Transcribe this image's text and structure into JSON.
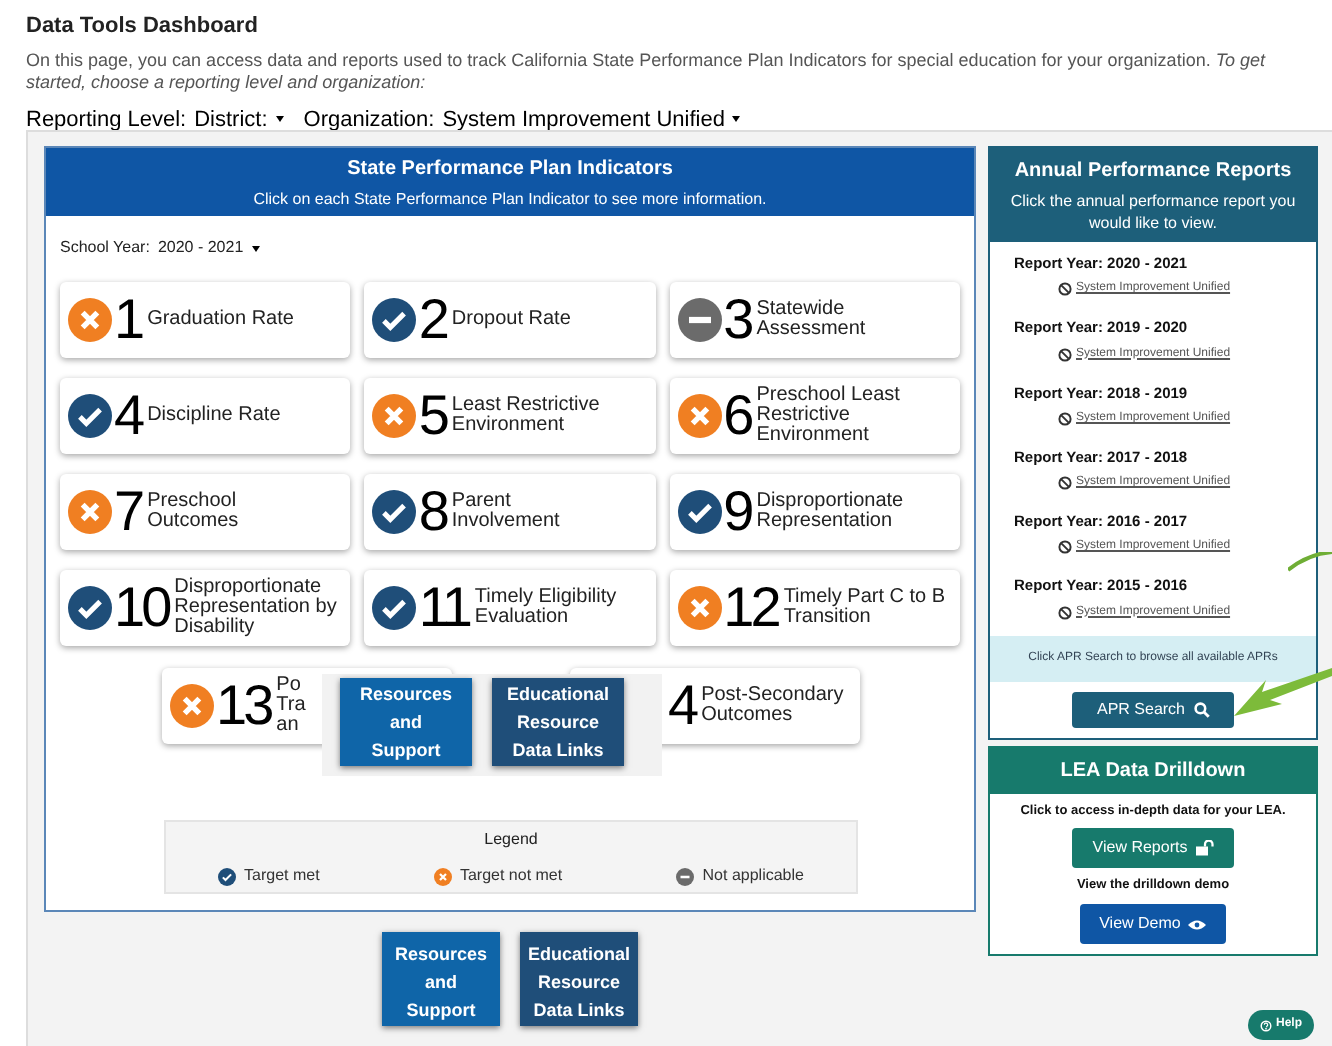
{
  "page": {
    "title": "Data Tools Dashboard",
    "intro": "On this page, you can access data and reports used to track California State Performance Plan Indicators for special education for your organization. *To get started, choose a reporting level and organization:*"
  },
  "filters": [
    {
      "label": "Reporting Level:",
      "value": "District:"
    },
    {
      "label": "Organization:",
      "value": "System Improvement Unified"
    }
  ],
  "indicators_panel": {
    "title": "State Performance Plan Indicators",
    "subtitle": "Click on each State Performance Plan Indicator to see more information.",
    "school_year_label": "School Year:",
    "school_year": "2020 - 2021",
    "indicators": [
      {
        "kind": "not_met",
        "number": "1",
        "label": [
          "Graduation Rate"
        ]
      },
      {
        "kind": "met",
        "number": "2",
        "label": [
          "Dropout Rate"
        ]
      },
      {
        "kind": "na",
        "number": "3",
        "label": [
          "Statewide",
          "Assessment"
        ]
      },
      {
        "kind": "met",
        "number": "4",
        "label": [
          "Discipline Rate"
        ]
      },
      {
        "kind": "not_met",
        "number": "5",
        "label": [
          "Least Restrictive",
          "Environment"
        ]
      },
      {
        "kind": "not_met",
        "number": "6",
        "label": [
          "Preschool Least",
          "Restrictive",
          "Environment"
        ]
      },
      {
        "kind": "not_met",
        "number": "7",
        "label": [
          "Preschool",
          "Outcomes"
        ]
      },
      {
        "kind": "met",
        "number": "8",
        "label": [
          "Parent",
          "Involvement"
        ]
      },
      {
        "kind": "met",
        "number": "9",
        "label": [
          "Disproportionate",
          "Representation"
        ]
      },
      {
        "kind": "met",
        "number": "10",
        "label": [
          "Disproportionate",
          "Representation by",
          "Disability"
        ]
      },
      {
        "kind": "met",
        "number": "11",
        "label": [
          "Timely Eligibility",
          "Evaluation"
        ]
      },
      {
        "kind": "not_met",
        "number": "12",
        "label": [
          "Timely Part C to B",
          "Transition"
        ]
      }
    ],
    "partial_indicators": [
      {
        "kind": "not_met",
        "number": "13",
        "label": [
          "Po",
          "Tra",
          "an"
        ]
      },
      {
        "number": "4",
        "label": [
          "Post-Secondary",
          "Outcomes"
        ]
      }
    ],
    "overlay_links": [
      {
        "kind": "light",
        "lines": [
          "Resources",
          "and",
          "Support"
        ]
      },
      {
        "kind": "dark",
        "lines": [
          "Educational",
          "Resource",
          "Data Links"
        ]
      }
    ],
    "legend": {
      "title": "Legend",
      "items": [
        {
          "kind": "met",
          "label": "Target met"
        },
        {
          "kind": "not_met",
          "label": "Target not met"
        },
        {
          "kind": "na",
          "label": "Not applicable"
        }
      ]
    }
  },
  "bottom_links": [
    {
      "kind": "light",
      "lines": [
        "Resources",
        "and",
        "Support"
      ]
    },
    {
      "kind": "dark",
      "lines": [
        "Educational",
        "Resource",
        "Data Links"
      ]
    }
  ],
  "apr_panel": {
    "title": "Annual Performance Reports",
    "subtitle": "Click the annual performance report you would like to view.",
    "reports": [
      {
        "year": "Report Year: 2020 - 2021",
        "link": "System Improvement Unified"
      },
      {
        "year": "Report Year: 2019 - 2020",
        "link": "System Improvement Unified"
      },
      {
        "year": "Report Year: 2018 - 2019",
        "link": "System Improvement Unified"
      },
      {
        "year": "Report Year: 2017 - 2018",
        "link": "System Improvement Unified"
      },
      {
        "year": "Report Year: 2016 - 2017",
        "link": "System Improvement Unified"
      },
      {
        "year": "Report Year: 2015 - 2016",
        "link": "System Improvement Unified"
      }
    ],
    "note": "Click APR Search to browse all available APRs",
    "button": "APR Search"
  },
  "drilldown_panel": {
    "title": "LEA Data Drilldown",
    "text": "Click to access in-depth data for your LEA.",
    "button": "View Reports",
    "demo_text": "View the drilldown demo",
    "demo_button": "View Demo"
  },
  "help_button": "Help"
}
